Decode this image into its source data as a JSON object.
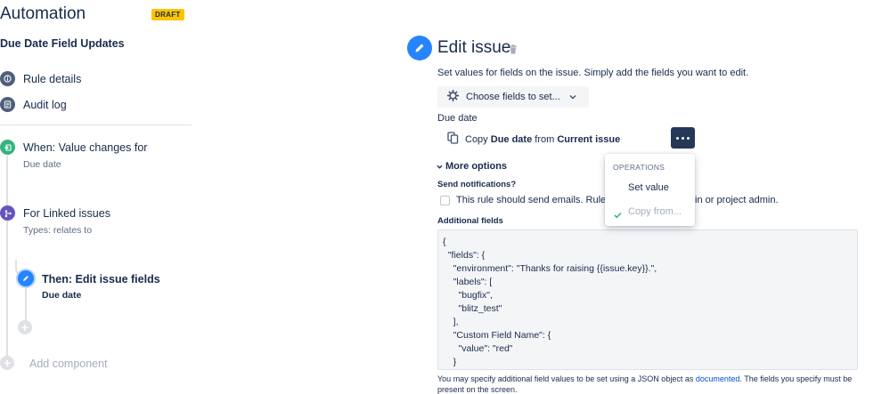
{
  "app": {
    "title": "Automation",
    "badge": "DRAFT"
  },
  "rule": {
    "name": "Due Date Field Updates"
  },
  "sidebar": {
    "links": [
      {
        "label": "Rule details",
        "icon": "info-icon"
      },
      {
        "label": "Audit log",
        "icon": "log-icon"
      }
    ],
    "steps": [
      {
        "title": "When: Value changes for",
        "subtitle": "Due date",
        "icon": "trigger-icon",
        "color": "#36b37e"
      },
      {
        "title": "For Linked issues",
        "subtitle": "Types: relates to",
        "icon": "branch-icon",
        "color": "#6554c0"
      },
      {
        "title": "Then: Edit issue fields",
        "subtitle": "Due date",
        "icon": "pencil-icon",
        "color": "#2684ff"
      }
    ],
    "add_component": "Add component"
  },
  "main": {
    "title": "Edit issue",
    "intro": "Set values for fields on the issue. Simply add the fields you want to edit.",
    "choose_fields": "Choose fields to set...",
    "field_label": "Due date",
    "copy_row": {
      "prefix": "Copy",
      "field": "Due date",
      "middle": "from",
      "source": "Current issue"
    },
    "more_options": "More options",
    "send_notifications": {
      "label": "Send notifications?",
      "text_start": "This rule should send emails. Rule",
      "text_end": "in or project admin."
    },
    "additional_fields_label": "Additional fields",
    "json_lines": [
      "{",
      "  \"fields\": {",
      "    \"environment\": \"Thanks for raising {{issue.key}}.\",",
      "    \"labels\": [",
      "      \"bugfix\",",
      "      \"blitz_test\"",
      "    ],",
      "    \"Custom Field Name\": {",
      "      \"value\": \"red\"",
      "    }"
    ],
    "help": {
      "before": "You may specify additional field values to be set using a JSON object as ",
      "link": "documented",
      "after": ". The fields you specify must be present on the screen."
    }
  },
  "operations_menu": {
    "heading": "OPERATIONS",
    "items": [
      {
        "label": "Set value",
        "selected": false
      },
      {
        "label": "Copy from...",
        "selected": true
      }
    ]
  },
  "colors": {
    "accent": "#2684ff",
    "draft_badge": "#ffc400",
    "text": "#172b4d",
    "link": "#0052cc",
    "more_button": "#253858"
  }
}
